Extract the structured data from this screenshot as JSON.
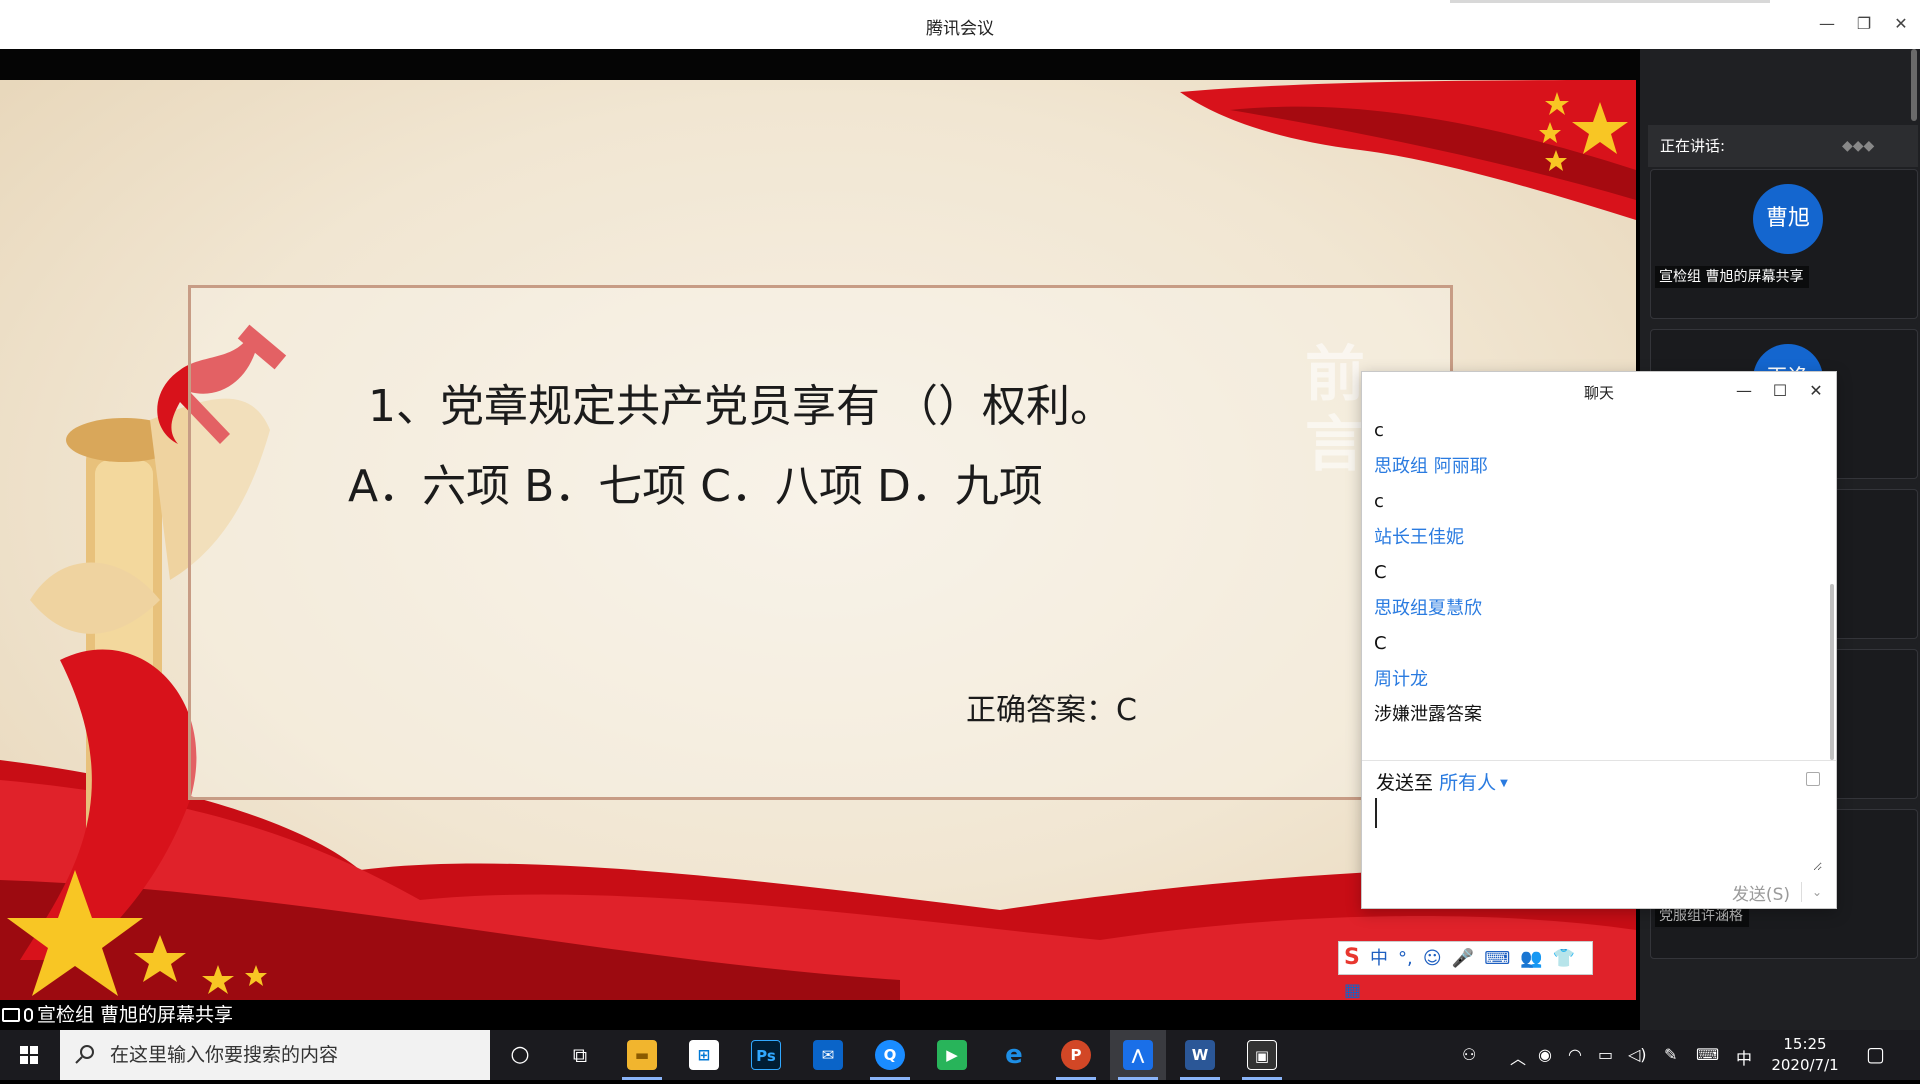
{
  "app": {
    "title": "腾讯会议",
    "window_buttons": {
      "minimize": "—",
      "restore": "❐",
      "close": "✕"
    }
  },
  "slide": {
    "question": "1、党章规定共产党员享有 （）权利。",
    "options": "A．六项 B．七项 C．八项 D．九项",
    "answer": "正确答案：C",
    "ghost_text": "前言"
  },
  "share_bar": {
    "label": "宣检组 曹旭的屏幕共享"
  },
  "right_panel": {
    "speaking_label": "正在讲话:",
    "tiles": [
      {
        "avatar_text": "曹旭",
        "label": "宣检组 曹旭的屏幕共享"
      },
      {
        "avatar_text": "王逸",
        "label": ""
      },
      {
        "avatar_text": "",
        "label": ""
      },
      {
        "avatar_text": "",
        "label": ""
      },
      {
        "avatar_text": "",
        "label": "党服组许涵格"
      }
    ]
  },
  "chat": {
    "title": "聊天",
    "messages": [
      {
        "type": "text",
        "value": "c"
      },
      {
        "type": "name",
        "value": "思政组  阿丽耶"
      },
      {
        "type": "text",
        "value": "c"
      },
      {
        "type": "name",
        "value": "站长王佳妮"
      },
      {
        "type": "text",
        "value": "C"
      },
      {
        "type": "name",
        "value": "思政组夏慧欣"
      },
      {
        "type": "text",
        "value": "C"
      },
      {
        "type": "name",
        "value": "周计龙"
      },
      {
        "type": "text",
        "value": "涉嫌泄露答案"
      }
    ],
    "send_to_label": "发送至",
    "send_to_target": "所有人",
    "send_button": "发送(S)",
    "input_value": ""
  },
  "ime_toolbar": {
    "items": [
      "S",
      "中",
      "°,",
      "☺",
      "🎤",
      "⌨",
      "👥",
      "👕",
      "▦"
    ]
  },
  "taskbar": {
    "search_placeholder": "在这里输入你要搜索的内容",
    "apps": [
      {
        "name": "cortana",
        "glyph": "○"
      },
      {
        "name": "task-view",
        "glyph": "⧉"
      },
      {
        "name": "file-explorer",
        "glyph": "▬"
      },
      {
        "name": "store",
        "glyph": "⊞"
      },
      {
        "name": "photoshop",
        "glyph": "Ps"
      },
      {
        "name": "mail",
        "glyph": "✉"
      },
      {
        "name": "browser-q",
        "glyph": "Q"
      },
      {
        "name": "media-player",
        "glyph": "▶"
      },
      {
        "name": "edge",
        "glyph": "e"
      },
      {
        "name": "powerpoint",
        "glyph": "P"
      },
      {
        "name": "tencent-meeting",
        "glyph": "⋀"
      },
      {
        "name": "word",
        "glyph": "W"
      },
      {
        "name": "camera",
        "glyph": "▣"
      }
    ],
    "tray_ime": "中",
    "time": "15:25",
    "date": "2020/7/1"
  },
  "colors": {
    "accent_blue": "#2a7be0",
    "avatar_blue": "#1466cf",
    "party_red": "#d8121b"
  }
}
